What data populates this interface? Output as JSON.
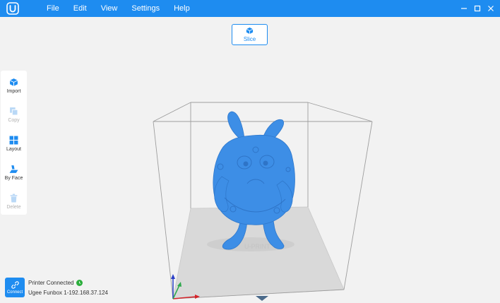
{
  "menu": {
    "items": [
      "File",
      "Edit",
      "View",
      "Settings",
      "Help"
    ]
  },
  "slice": {
    "label": "Slice"
  },
  "toolbar": {
    "items": [
      {
        "label": "Import",
        "icon": "import-icon",
        "enabled": true
      },
      {
        "label": "Copy",
        "icon": "copy-icon",
        "enabled": false
      },
      {
        "label": "Layout",
        "icon": "layout-icon",
        "enabled": true
      },
      {
        "label": "By Face",
        "icon": "by-face-icon",
        "enabled": true
      },
      {
        "label": "Delete",
        "icon": "delete-icon",
        "enabled": false
      }
    ]
  },
  "status": {
    "connect_label": "Connect",
    "printer_state": "Printer Connected",
    "printer_address": "Ugee Funbox 1-192.168.37.124"
  },
  "colors": {
    "accent": "#1e8cf0",
    "model": "#3d8ee6",
    "connected": "#2cae3c"
  }
}
